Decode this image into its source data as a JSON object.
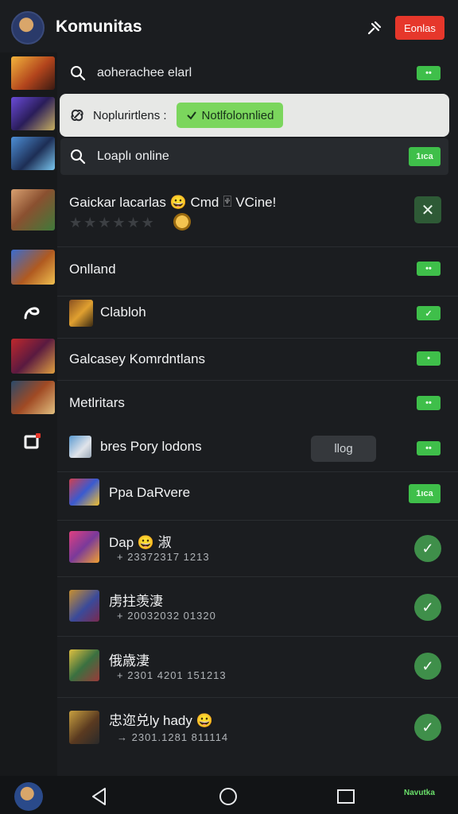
{
  "header": {
    "title": "Komunitas",
    "action_button": "Eonlas",
    "pin_icon": "pin-icon"
  },
  "search_row": {
    "label": "aoherachee elarl"
  },
  "popup": {
    "label": "Noplurirtlens :",
    "button": "Notlfolonnlied"
  },
  "online_row": {
    "label": "Loaplı online",
    "badge": "1ıca"
  },
  "profile": {
    "name": "Gaickar lacarlas 😀 Cmd 🂿 VCine!",
    "rating_stars": 0
  },
  "list": [
    {
      "title": "Onlland"
    },
    {
      "title": "Clabloh"
    },
    {
      "title": "Galcasey Komrdntlans"
    },
    {
      "title": "Metlritars"
    },
    {
      "title": "bres Pory lodons",
      "button": "llog"
    },
    {
      "title": "Ppa DaRvere",
      "badge": "1ıca"
    }
  ],
  "chats": [
    {
      "title": "Dap 😀 淑",
      "sub": "+ 23372317 1213"
    },
    {
      "title": "虏拄羡淒",
      "sub": "+ 20032032 01320"
    },
    {
      "title": "俄歳淒",
      "sub": "+ 2301 4201 151213"
    },
    {
      "title": "忠迩兑ly hady 😀",
      "sub": "→ 2301.1281 811114"
    }
  ],
  "nav": {
    "right_label": "Navutka"
  },
  "colors": {
    "accent_green": "#3fbf4a",
    "red": "#e6372b",
    "bg": "#1b1d20"
  }
}
